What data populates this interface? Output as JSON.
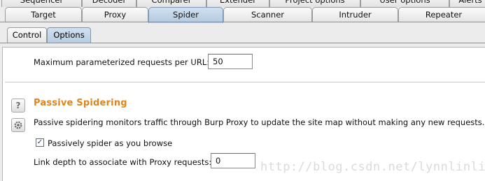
{
  "main_tabs_back": [
    {
      "label": "Sequencer"
    },
    {
      "label": "Decoder"
    },
    {
      "label": "Comparer"
    },
    {
      "label": "Extender"
    },
    {
      "label": "Project options"
    },
    {
      "label": "User options"
    },
    {
      "label": "Alerts"
    }
  ],
  "main_tabs_front": [
    {
      "label": "Target"
    },
    {
      "label": "Proxy"
    },
    {
      "label": "Spider",
      "active": true
    },
    {
      "label": "Scanner"
    },
    {
      "label": "Intruder"
    },
    {
      "label": "Repeater"
    }
  ],
  "sub_tabs": [
    {
      "label": "Control"
    },
    {
      "label": "Options",
      "active": true
    }
  ],
  "options": {
    "max_param_label": "Maximum parameterized requests per URL:",
    "max_param_value": "50",
    "passive": {
      "title": "Passive Spidering",
      "help_icon": "?",
      "settings_icon": "gear-icon",
      "description": "Passive spidering monitors traffic through Burp Proxy to update the site map without making any new requests.",
      "checkbox_label": "Passively spider as you browse",
      "checkbox_checked": true,
      "link_depth_label": "Link depth to associate with Proxy requests:",
      "link_depth_value": "0"
    }
  },
  "watermark": "http://blog.csdn.net/lynnlinlin",
  "colors": {
    "section_title": "#e0851d",
    "active_tab": "#b4c9de"
  }
}
